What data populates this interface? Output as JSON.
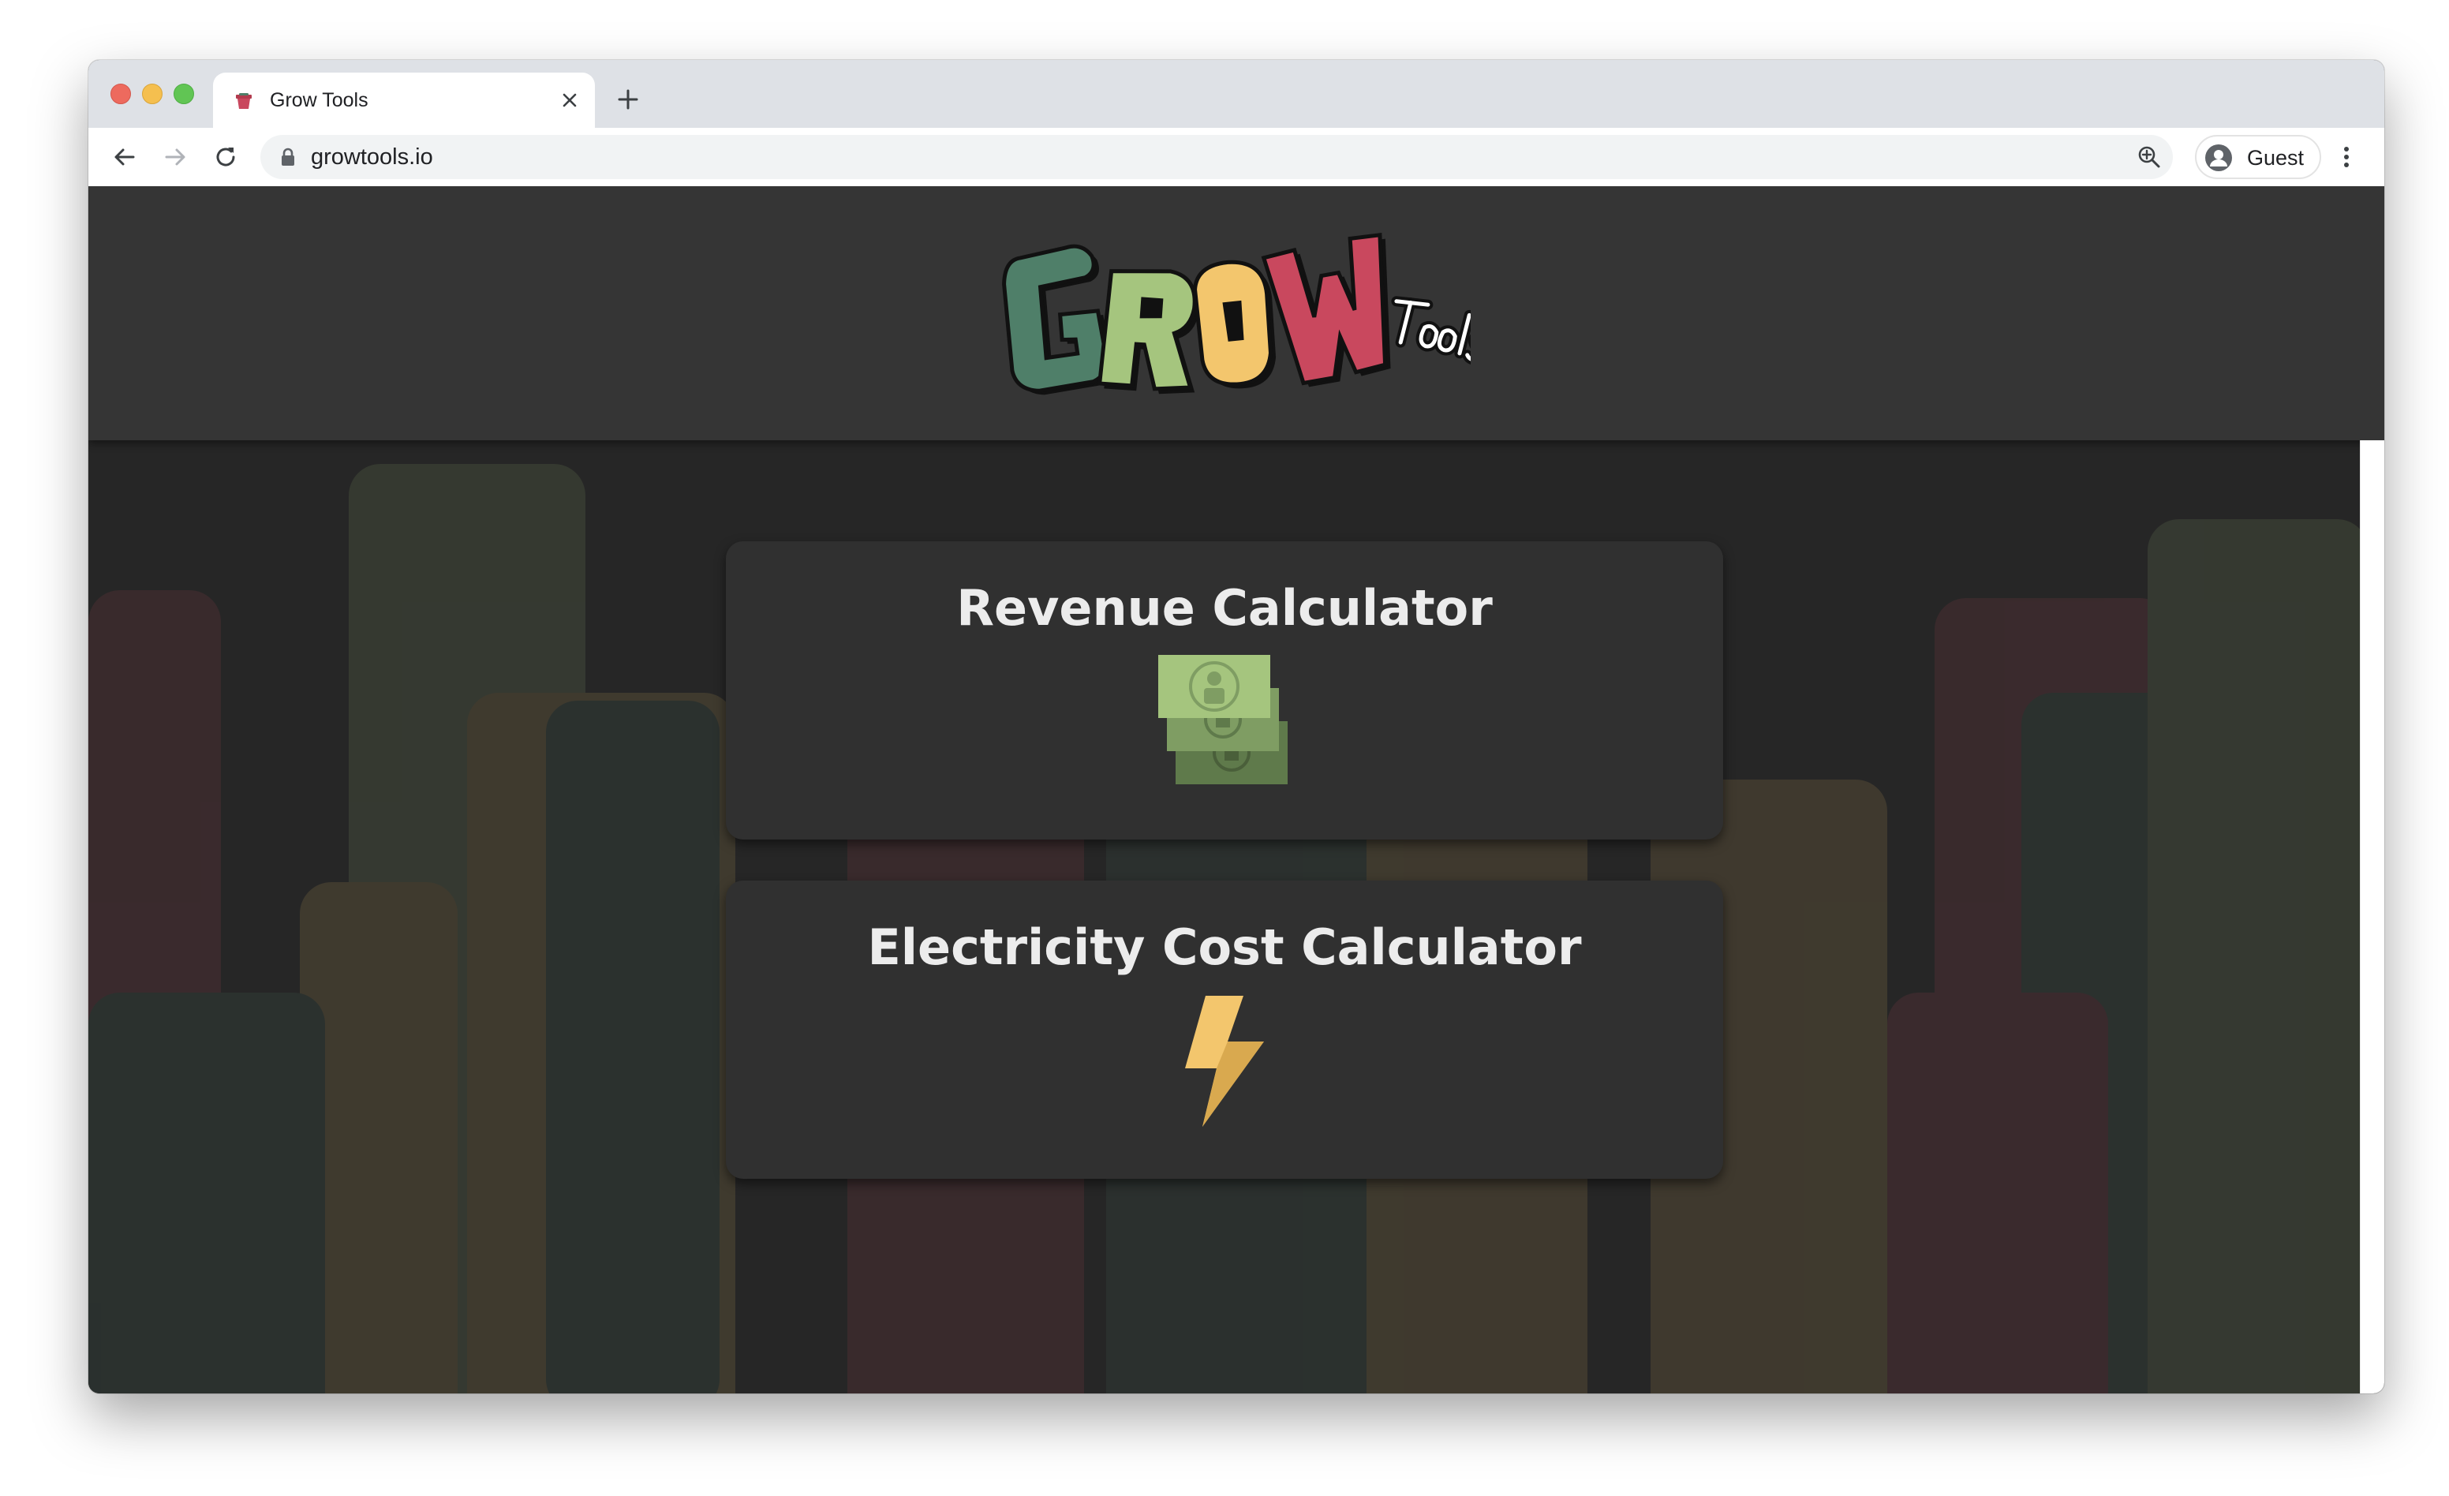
{
  "browser": {
    "tab": {
      "title": "Grow Tools",
      "favicon": "flower-pot-icon"
    },
    "address_bar": {
      "url": "growtools.io",
      "lock_icon": "lock-icon"
    },
    "profile": {
      "label": "Guest",
      "icon": "avatar-icon"
    }
  },
  "site": {
    "logo": {
      "icon": "grow-tools-logo"
    },
    "cards": [
      {
        "title": "Revenue Calculator",
        "icon": "money-stack-icon"
      },
      {
        "title": "Electricity Cost Calculator",
        "icon": "lightning-bolt-icon"
      }
    ],
    "colors": {
      "dark_green": "#4f7f69",
      "light_green": "#a5c57e",
      "yellow": "#f3c66d",
      "red": "#c9485e",
      "header_bg": "#353535",
      "card_bg": "#303030",
      "page_bg": "#262626"
    }
  }
}
